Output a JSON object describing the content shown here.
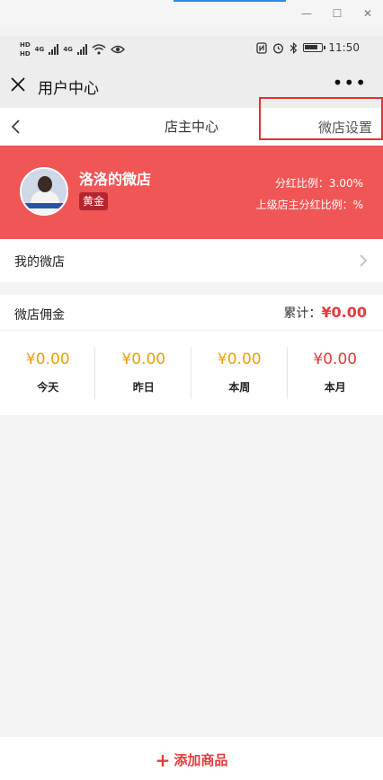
{
  "status_bar": {
    "time": "11:50",
    "hd1": "HD",
    "hd2": "HD",
    "net1": "4G",
    "net2": "4G"
  },
  "title_bar": {
    "title": "用户中心",
    "more": "•••"
  },
  "page_header": {
    "title": "店主中心",
    "settings_link": "微店设置"
  },
  "shop": {
    "name": "洛洛的微店",
    "level_badge": "黄金",
    "dividend_ratio": "分红比例：3.00%",
    "parent_dividend_ratio": "上级店主分红比例：%"
  },
  "my_shop": {
    "label": "我的微店"
  },
  "commission": {
    "label": "微店佣金",
    "total_label": "累计：",
    "total_value": "¥0.00",
    "stats": [
      {
        "amount": "¥0.00",
        "period": "今天",
        "color": "#f0a000"
      },
      {
        "amount": "¥0.00",
        "period": "昨日",
        "color": "#f0a000"
      },
      {
        "amount": "¥0.00",
        "period": "本周",
        "color": "#f0a000"
      },
      {
        "amount": "¥0.00",
        "period": "本月",
        "color": "#e53a3a"
      }
    ]
  },
  "bottom": {
    "add_product": "添加商品"
  },
  "colors": {
    "banner": "#f15656",
    "accent_red": "#e53a3a",
    "amount_orange": "#f0a000"
  }
}
